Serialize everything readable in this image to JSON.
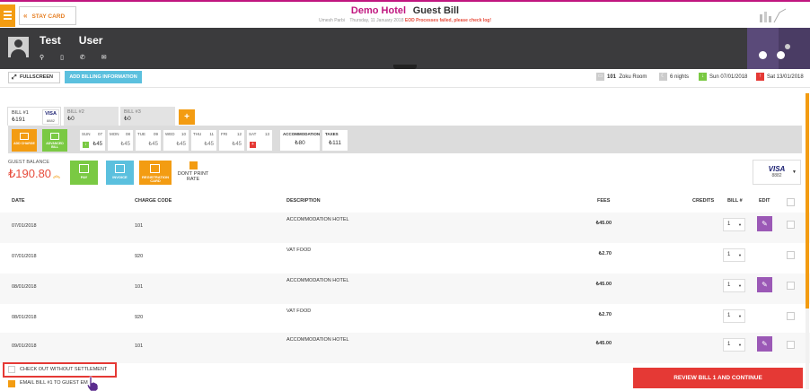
{
  "header": {
    "menu_icon": "hamburger-icon",
    "stay_card": "STAY CARD",
    "hotel_name": "Demo Hotel",
    "page_title": "Guest Bill",
    "user": "Umesh Parbi",
    "date": "Thursday, 11 January 2018",
    "error_msg": "EOD Processes failed, please check log!"
  },
  "guest": {
    "first_name": "Test",
    "last_name": "User",
    "icons": [
      "location-icon",
      "mobile-icon",
      "phone-icon",
      "email-icon"
    ]
  },
  "actions": {
    "fullscreen": "FULLSCREEN",
    "add_billing": "ADD BILLING INFORMATION",
    "room_number": "101",
    "room_type": "Zoku Room",
    "nights": "6 nights",
    "arrival": "Sun 07/01/2018",
    "departure": "Sat 13/01/2018"
  },
  "bills": [
    {
      "label": "BILL #1",
      "amount": "₺191",
      "card": "VISA",
      "card_last": "8882"
    },
    {
      "label": "BILL #2",
      "amount": "₺0"
    },
    {
      "label": "BILL #3",
      "amount": "₺0"
    }
  ],
  "add_bill": "+",
  "calendar": {
    "add_charge": "ADD CHARGE",
    "advanced_bill": "ADVANCED BILL",
    "days": [
      {
        "day": "SUN",
        "date": "07",
        "price": "₺45"
      },
      {
        "day": "MON",
        "date": "08",
        "price": "₺45"
      },
      {
        "day": "TUE",
        "date": "09",
        "price": "₺45"
      },
      {
        "day": "WED",
        "date": "10",
        "price": "₺45"
      },
      {
        "day": "THU",
        "date": "11",
        "price": "₺45"
      },
      {
        "day": "FRI",
        "date": "12",
        "price": "₺45"
      },
      {
        "day": "SAT",
        "date": "13",
        "price": ""
      }
    ],
    "accommodation_label": "ACCOMMODATION",
    "accommodation_value": "₺80",
    "taxes_label": "TAXES",
    "taxes_value": "₺111"
  },
  "balance": {
    "label": "GUEST BALANCE",
    "value": "₺190.80",
    "pay": "PAY",
    "invoice": "INVOICE",
    "registration_card": "REGISTRATION CARD",
    "dont_print_rate": "DON'T PRINT RATE",
    "card_brand": "VISA",
    "card_last": "8882"
  },
  "table": {
    "headers": {
      "date": "DATE",
      "charge_code": "CHARGE CODE",
      "description": "DESCRIPTION",
      "fees": "FEES",
      "credits": "CREDITS",
      "bill": "BILL #",
      "edit": "EDIT"
    },
    "rows": [
      {
        "date": "07/01/2018",
        "code": "101",
        "desc": "ACCOMMODATION HOTEL",
        "fee": "₺45.00",
        "bill": "1",
        "editable": true
      },
      {
        "date": "07/01/2018",
        "code": "920",
        "desc": "VAT FOOD",
        "fee": "₺2.70",
        "bill": "1",
        "editable": false
      },
      {
        "date": "08/01/2018",
        "code": "101",
        "desc": "ACCOMMODATION HOTEL",
        "fee": "₺45.00",
        "bill": "1",
        "editable": true
      },
      {
        "date": "08/01/2018",
        "code": "920",
        "desc": "VAT FOOD",
        "fee": "₺2.70",
        "bill": "1",
        "editable": false
      },
      {
        "date": "09/01/2018",
        "code": "101",
        "desc": "ACCOMMODATION HOTEL",
        "fee": "₺45.00",
        "bill": "1",
        "editable": true
      }
    ]
  },
  "footer": {
    "checkout": "CHECK OUT WITHOUT SETTLEMENT",
    "email_bill": "EMAIL BILL #1 TO GUEST EM",
    "review": "REVIEW BILL 1 AND CONTINUE"
  },
  "colors": {
    "accent": "#f39c12",
    "brand": "#c0167f",
    "danger": "#e53935",
    "edit": "#9b59b6",
    "green": "#7ac943",
    "info": "#5bc0de"
  }
}
